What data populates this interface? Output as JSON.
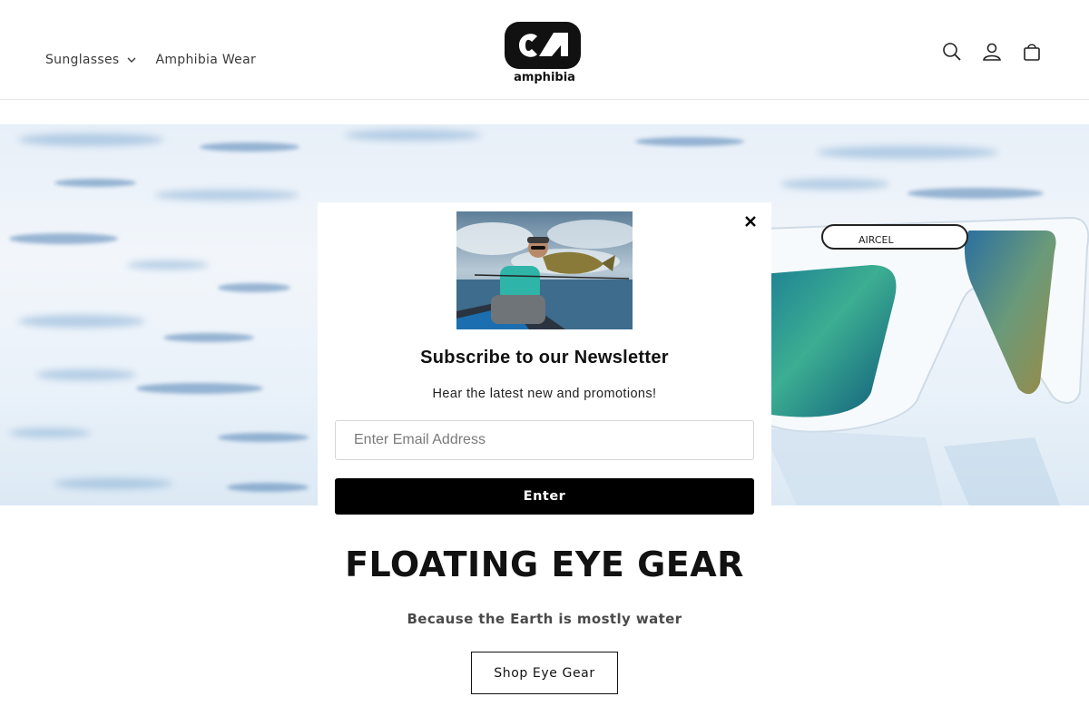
{
  "header": {
    "nav": [
      {
        "label": "Sunglasses",
        "has_dropdown": true,
        "icon": "chevron-down-icon"
      },
      {
        "label": "Amphibia Wear",
        "has_dropdown": false
      }
    ],
    "logo_text": "amphibia",
    "icons": [
      "search-icon",
      "account-icon",
      "cart-icon"
    ]
  },
  "hero": {
    "product_brand_text": "AIRCEL"
  },
  "modal": {
    "title": "Subscribe to our Newsletter",
    "subtitle": "Hear the latest new and promotions!",
    "email_placeholder": "Enter Email Address",
    "email_value": "",
    "submit_label": "Enter",
    "close_icon": "close-icon"
  },
  "main": {
    "headline": "FLOATING EYE GEAR",
    "tagline": "Because the Earth is mostly water",
    "cta_label": "Shop Eye Gear"
  },
  "colors": {
    "button_bg": "#000000",
    "text": "#121212",
    "lens_teal": "#2f9e8f"
  }
}
